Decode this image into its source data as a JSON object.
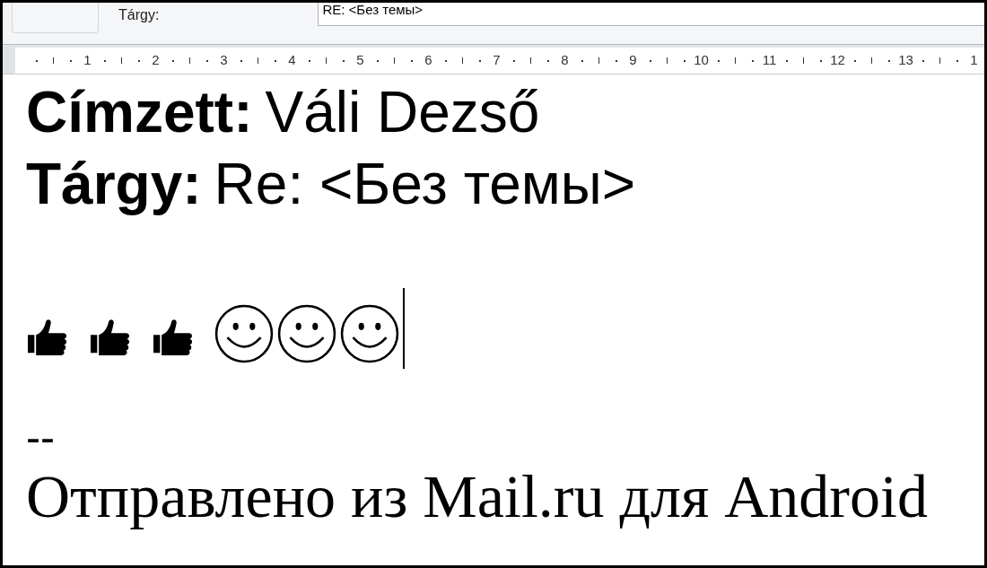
{
  "header": {
    "subject_label": "Tárgy:",
    "subject_value": "RE: <Без темы>"
  },
  "ruler": [
    "1",
    "2",
    "3",
    "4",
    "5",
    "6",
    "7",
    "8",
    "9",
    "10",
    "11",
    "12",
    "13",
    "1"
  ],
  "body": {
    "lines": [
      {
        "label": "Címzett:",
        "value": "Váli Dezső"
      },
      {
        "label": "Tárgy:",
        "value": "Re: <Без темы>"
      }
    ],
    "emoji": [
      {
        "kind": "thumbs-up"
      },
      {
        "kind": "thumbs-up"
      },
      {
        "kind": "thumbs-up"
      },
      {
        "kind": "smiley"
      },
      {
        "kind": "smiley"
      },
      {
        "kind": "smiley"
      }
    ],
    "separator": "--",
    "signature": "Отправлено из Mail.ru для Android"
  }
}
